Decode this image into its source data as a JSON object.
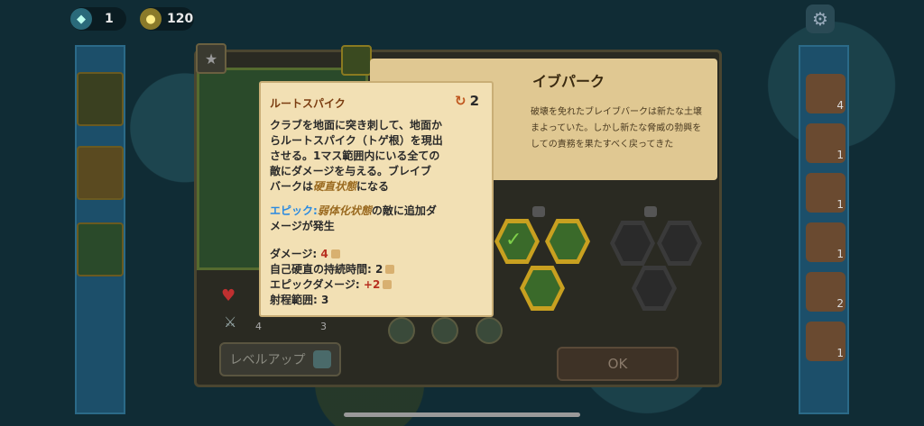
{
  "hud": {
    "gems": "1",
    "coins": "120"
  },
  "popup": {
    "title": "ルートスパイク",
    "cooldown": "2",
    "description_lines": [
      "クラブを地面に突き刺して、地面か",
      "らルートスパイク（トゲ根）を現出",
      "させる。1マス範囲内にいる全ての",
      "敵にダメージを与える。ブレイブ"
    ],
    "desc_last_prefix": "バークは",
    "desc_last_status": "硬直状態",
    "desc_last_suffix": "になる",
    "epic_label": "エピック:",
    "epic_status": "弱体化状態",
    "epic_text_1": "の敵に追加ダ",
    "epic_text_2": "メージが発生",
    "stats": {
      "damage_label": "ダメージ:",
      "damage_value": "4",
      "stun_label": "自己硬直の持続時間:",
      "stun_value": "2",
      "epic_damage_label": "エピックダメージ:",
      "epic_damage_value": "+2",
      "range_label": "射程範囲:",
      "range_value": "3"
    }
  },
  "story": {
    "heading": "イブパーク",
    "lines": [
      "破壊を免れたブレイブバークは新たな土壌",
      "まよっていた。しかし新たな脅威の勃興を",
      "しての責務を果たすべく戻ってきた"
    ]
  },
  "right_inventory": [
    {
      "icon": "wood-bundle-icon",
      "count": "4"
    },
    {
      "icon": "leaf-icon",
      "count": "1"
    },
    {
      "icon": "stone-icon",
      "count": "1"
    },
    {
      "icon": "nest-icon",
      "count": "1"
    },
    {
      "icon": "potion-icon",
      "count": "2"
    },
    {
      "icon": "torch-icon",
      "count": "1"
    }
  ],
  "hero_stats": {
    "stat1": "4",
    "stat2": "3"
  },
  "buttons": {
    "level_up": "レベルアップ",
    "ok": "OK"
  },
  "colors": {
    "epic": "#2a8ae0",
    "status": "#9a6a20",
    "damage": "#b83020",
    "title": "#7a3c10"
  }
}
